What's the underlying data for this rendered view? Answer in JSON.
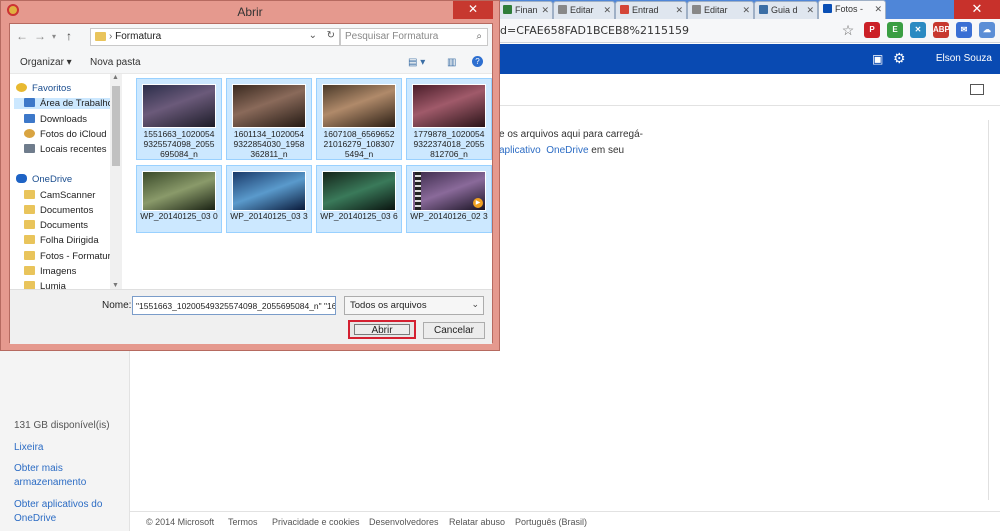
{
  "browser": {
    "tabs": [
      {
        "label": "Finan",
        "color": "#2f7d3a"
      },
      {
        "label": "Editar",
        "color": "#888888"
      },
      {
        "label": "Entrad",
        "color": "#d44638"
      },
      {
        "label": "Editar",
        "color": "#888888"
      },
      {
        "label": "Guia d",
        "color": "#3b6ea5"
      },
      {
        "label": "Fotos -",
        "color": "#0a4fb5"
      }
    ],
    "url": "d=CFAE658FAD1BCEB8%2115159",
    "extensions": [
      {
        "name": "pinterest-icon",
        "label": "P",
        "color": "#cb2027"
      },
      {
        "name": "evernote-icon",
        "label": "E",
        "color": "#3a9e43"
      },
      {
        "name": "x-icon",
        "label": "✕",
        "color": "#2a8ac2"
      },
      {
        "name": "adblock-icon",
        "label": "ABP",
        "color": "#c7382f"
      },
      {
        "name": "mail-icon",
        "label": "✉",
        "color": "#3a6fd4"
      },
      {
        "name": "cloud-icon",
        "label": "☁",
        "color": "#5b8ed6"
      }
    ]
  },
  "onedrive": {
    "user": "Elson Souza",
    "drop_text_1": "e os arquivos aqui para carregá-",
    "drop_link_1": "aplicativo",
    "drop_link_2": "OneDrive",
    "drop_text_2": "em seu",
    "storage": "131 GB disponível(is)",
    "left_links": [
      "Lixeira",
      "Obter mais armazenamento",
      "Obter aplicativos do OneDrive"
    ],
    "footer": [
      "© 2014 Microsoft",
      "Termos",
      "Privacidade e cookies",
      "Desenvolvedores",
      "Relatar abuso",
      "Português (Brasil)"
    ]
  },
  "dialog": {
    "title": "Abrir",
    "path": "Formatura",
    "search_placeholder": "Pesquisar Formatura",
    "organize": "Organizar ▾",
    "new_folder": "Nova pasta",
    "nav_items": [
      {
        "label": "Favoritos",
        "icon": "star-icon",
        "color": "#e8b931",
        "header": true
      },
      {
        "label": "Área de Trabalho",
        "icon": "desktop-icon",
        "color": "#3d78c9",
        "header": false
      },
      {
        "label": "Downloads",
        "icon": "downloads-icon",
        "color": "#3d78c9",
        "header": false
      },
      {
        "label": "Fotos do iCloud",
        "icon": "icloud-icon",
        "color": "#d9a441",
        "header": false
      },
      {
        "label": "Locais recentes",
        "icon": "recent-icon",
        "color": "#6f7c8c",
        "header": false
      },
      {
        "label": "OneDrive",
        "icon": "onedrive-icon",
        "color": "#1e63c5",
        "header": true
      },
      {
        "label": "CamScanner",
        "icon": "folder-icon",
        "color": "#e9c45b",
        "header": false
      },
      {
        "label": "Documentos",
        "icon": "folder-icon",
        "color": "#e9c45b",
        "header": false
      },
      {
        "label": "Documents",
        "icon": "folder-icon",
        "color": "#e9c45b",
        "header": false
      },
      {
        "label": "Folha Dirigida",
        "icon": "folder-icon",
        "color": "#e9c45b",
        "header": false
      },
      {
        "label": "Fotos - Formatur",
        "icon": "folder-icon",
        "color": "#e9c45b",
        "header": false
      },
      {
        "label": "Imagens",
        "icon": "folder-icon",
        "color": "#e9c45b",
        "header": false
      },
      {
        "label": "Lumia",
        "icon": "folder-icon",
        "color": "#e9c45b",
        "header": false
      }
    ],
    "files": [
      {
        "name": "1551663_1020054 9325574098_2055 695084_n",
        "color": "#5a3a5e"
      },
      {
        "name": "1601134_1020054 9322854030_1958 362811_n",
        "color": "#6a4a3a"
      },
      {
        "name": "1607108_6569652 21016279_108307 5494_n",
        "color": "#7a5a4a"
      },
      {
        "name": "1779878_1020054 9322374018_2055 812706_n",
        "color": "#6a3a4a"
      },
      {
        "name": "WP_20140125_03 0",
        "color": "#4a5a3a"
      },
      {
        "name": "WP_20140125_03 3",
        "color": "#2a5a7a"
      },
      {
        "name": "WP_20140125_03 6",
        "color": "#2a4a3a"
      },
      {
        "name": "WP_20140126_02 3",
        "color": "#5a3a6a"
      }
    ],
    "name_label": "Nome:",
    "name_value": "\"1551663_10200549325574098_2055695084_n\" \"16",
    "file_type": "Todos os arquivos",
    "open_button": "Abrir",
    "cancel_button": "Cancelar"
  }
}
